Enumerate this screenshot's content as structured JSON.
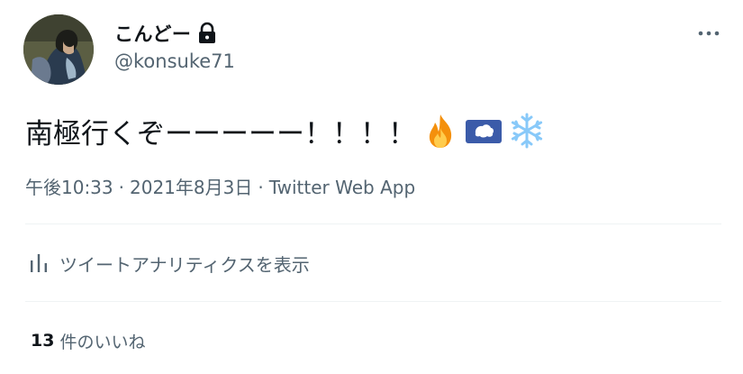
{
  "author": {
    "display_name": "こんどー",
    "handle": "@konsuke71"
  },
  "icons": {
    "lock": "lock-icon",
    "more": "more-dots-icon",
    "analytics": "bar-chart-icon",
    "emoji_1": "fire-emoji",
    "emoji_2": "antarctica-flag-emoji",
    "emoji_3": "snowflake-emoji"
  },
  "tweet": {
    "text": "南極行くぞーーーーー！！！！"
  },
  "meta": {
    "time": "午後10:33",
    "separator": "·",
    "date": "2021年8月3日",
    "source": "Twitter Web App"
  },
  "analytics": {
    "label": "ツイートアナリティクスを表示"
  },
  "likes": {
    "count": "13",
    "label": "件のいいね"
  },
  "colors": {
    "text_primary": "#0f1419",
    "text_secondary": "#536471",
    "divider": "#eff3f4",
    "flag_blue": "#3b5ba9"
  }
}
